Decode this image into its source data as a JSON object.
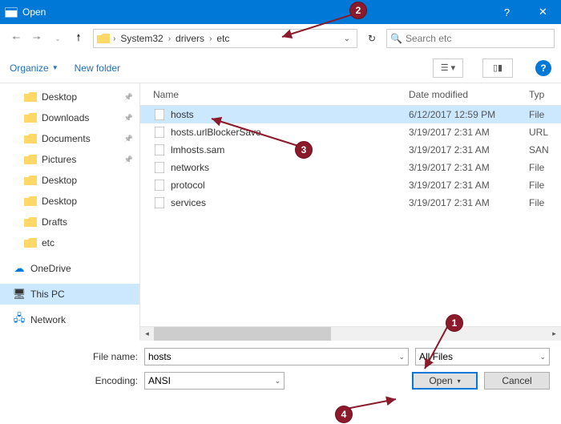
{
  "window": {
    "title": "Open"
  },
  "nav": {
    "breadcrumb": [
      "System32",
      "drivers",
      "etc"
    ],
    "search_placeholder": "Search etc"
  },
  "toolbar": {
    "organize": "Organize",
    "new_folder": "New folder"
  },
  "sidebar": {
    "items": [
      {
        "label": "Desktop",
        "icon": "folder",
        "pinned": true
      },
      {
        "label": "Downloads",
        "icon": "folder",
        "pinned": true
      },
      {
        "label": "Documents",
        "icon": "folder",
        "pinned": true
      },
      {
        "label": "Pictures",
        "icon": "folder",
        "pinned": true
      },
      {
        "label": "Desktop",
        "icon": "folder"
      },
      {
        "label": "Desktop",
        "icon": "folder"
      },
      {
        "label": "Drafts",
        "icon": "folder"
      },
      {
        "label": "etc",
        "icon": "folder"
      }
    ],
    "roots": [
      {
        "label": "OneDrive",
        "icon": "cloud"
      },
      {
        "label": "This PC",
        "icon": "pc",
        "selected": true
      },
      {
        "label": "Network",
        "icon": "network"
      }
    ]
  },
  "columns": {
    "name": "Name",
    "date": "Date modified",
    "type": "Typ"
  },
  "files": [
    {
      "name": "hosts",
      "date": "6/12/2017 12:59 PM",
      "type": "File",
      "selected": true
    },
    {
      "name": "hosts.urlBlockerSave",
      "date": "3/19/2017 2:31 AM",
      "type": "URL"
    },
    {
      "name": "lmhosts.sam",
      "date": "3/19/2017 2:31 AM",
      "type": "SAN"
    },
    {
      "name": "networks",
      "date": "3/19/2017 2:31 AM",
      "type": "File"
    },
    {
      "name": "protocol",
      "date": "3/19/2017 2:31 AM",
      "type": "File"
    },
    {
      "name": "services",
      "date": "3/19/2017 2:31 AM",
      "type": "File"
    }
  ],
  "form": {
    "filename_label": "File name:",
    "filename_value": "hosts",
    "filetype_value": "All Files",
    "encoding_label": "Encoding:",
    "encoding_value": "ANSI",
    "open": "Open",
    "cancel": "Cancel"
  },
  "callouts": {
    "1": "1",
    "2": "2",
    "3": "3",
    "4": "4"
  }
}
